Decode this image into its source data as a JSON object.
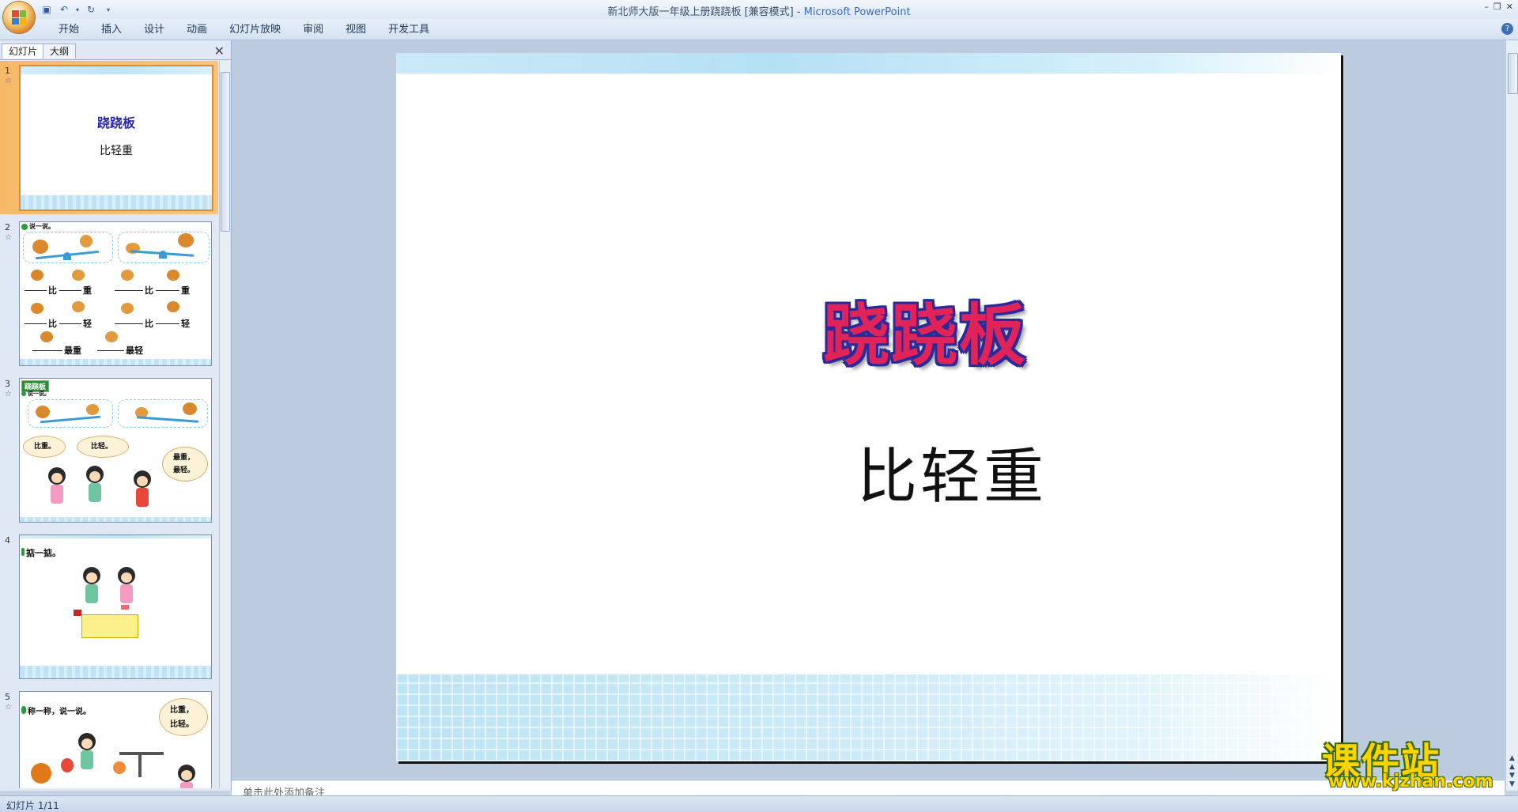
{
  "window": {
    "title": "新北师大版一年级上册跷跷板 [兼容模式] - ",
    "app_name": "Microsoft PowerPoint"
  },
  "ribbon": {
    "tabs": [
      "开始",
      "插入",
      "设计",
      "动画",
      "幻灯片放映",
      "审阅",
      "视图",
      "开发工具"
    ]
  },
  "left_pane": {
    "tabs": [
      "幻灯片",
      "大纲"
    ]
  },
  "thumbnails": [
    {
      "number": "1",
      "title": "跷跷板",
      "subtitle": "比轻重"
    },
    {
      "number": "2",
      "heading": "说一说。",
      "labels": [
        "比",
        "重",
        "比",
        "重",
        "比",
        "轻",
        "比",
        "轻",
        "最重",
        "最轻"
      ]
    },
    {
      "number": "3",
      "badge": "跷跷板",
      "heading": "说一说。",
      "bubbles": [
        "比重。",
        "比轻。",
        "最重，",
        "最轻。"
      ]
    },
    {
      "number": "4",
      "heading": "掂一掂。"
    },
    {
      "number": "5",
      "heading": "称一称，说一说。",
      "bubbles": [
        "比重，",
        "比轻。"
      ]
    }
  ],
  "slide": {
    "title": "跷跷板",
    "subtitle": "比轻重"
  },
  "notes": {
    "placeholder": "单击此处添加备注"
  },
  "status": {
    "slide_indicator": "幻灯片 1/11"
  },
  "watermark": {
    "name": "课件站",
    "url": "www.kjzhan.com"
  },
  "colors": {
    "title_fill": "#e0245a",
    "title_outline": "#2a2a9a",
    "selected_thumb": "#f6b968"
  }
}
